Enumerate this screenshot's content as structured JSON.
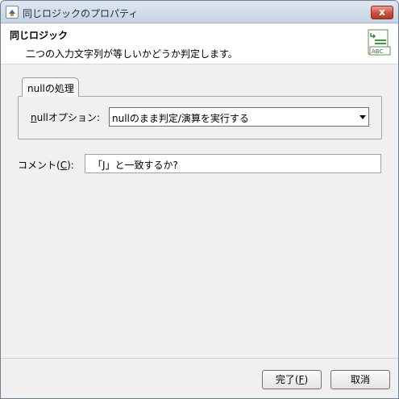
{
  "window": {
    "title": "同じロジックのプロパティ",
    "close_glyph": "x"
  },
  "header": {
    "title": "同じロジック",
    "description": "二つの入力文字列が等しいかどうか判定します。",
    "icon_text": "ABC"
  },
  "tab": {
    "label": "nullの処理"
  },
  "null_option": {
    "label_mnemonic": "n",
    "label_rest": "ullオプション:",
    "selected": "nullのまま判定/演算を実行する"
  },
  "comment": {
    "label_prefix": "コメント(",
    "label_mnemonic": "C",
    "label_suffix": "):",
    "value": "「J」と一致するか?"
  },
  "buttons": {
    "ok_prefix": "完了(",
    "ok_mnemonic": "F",
    "ok_suffix": ")",
    "cancel": "取消"
  }
}
